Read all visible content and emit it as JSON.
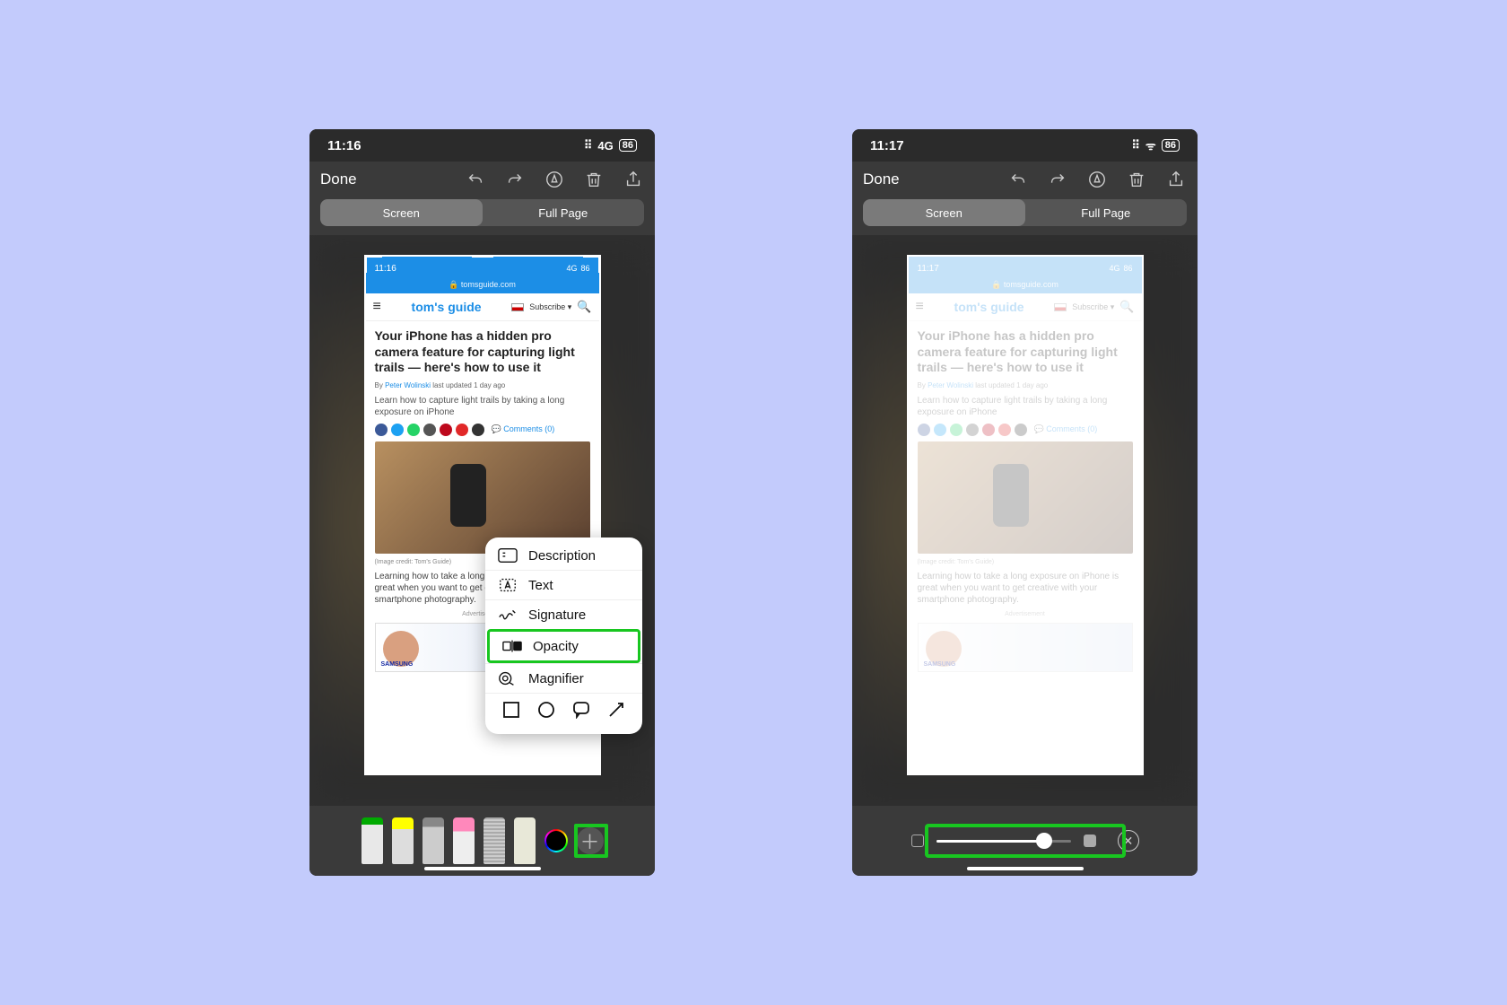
{
  "phone1": {
    "status": {
      "time": "11:16",
      "network": "4G",
      "battery": "86"
    },
    "nav": {
      "done": "Done"
    },
    "tabs": {
      "screen": "Screen",
      "fullpage": "Full Page"
    },
    "inner_status": {
      "time": "11:16",
      "network": "4G",
      "battery": "86",
      "url": "tomsguide.com"
    },
    "site": {
      "brand": "tom's guide",
      "subscribe": "Subscribe ▾"
    },
    "article": {
      "headline": "Your iPhone has a hidden pro camera feature for capturing light trails — here's how to use it",
      "by_prefix": "By ",
      "author": "Peter Wolinski",
      "by_suffix": " last updated 1 day ago",
      "sub": "Learn how to capture light trails by taking a long exposure on iPhone",
      "comments": "Comments (0)",
      "credit": "(Image credit: Tom's Guide)",
      "body": "Learning how to take a long exposure on iPhone is great when you want to get creative with your smartphone photography.",
      "adlabel": "Advertisement",
      "adtag": "SAMSUNG"
    },
    "popup": {
      "description": "Description",
      "text": "Text",
      "signature": "Signature",
      "opacity": "Opacity",
      "magnifier": "Magnifier"
    }
  },
  "phone2": {
    "status": {
      "time": "11:17",
      "network": "",
      "battery": "86"
    },
    "nav": {
      "done": "Done"
    },
    "tabs": {
      "screen": "Screen",
      "fullpage": "Full Page"
    },
    "inner_status": {
      "time": "11:17",
      "network": "4G",
      "battery": "86",
      "url": "tomsguide.com"
    },
    "site": {
      "brand": "tom's guide",
      "subscribe": "Subscribe ▾"
    },
    "article": {
      "headline": "Your iPhone has a hidden pro camera feature for capturing light trails — here's how to use it",
      "by_prefix": "By ",
      "author": "Peter Wolinski",
      "by_suffix": " last updated 1 day ago",
      "sub": "Learn how to capture light trails by taking a long exposure on iPhone",
      "comments": "Comments (0)",
      "credit": "(Image credit: Tom's Guide)",
      "body": "Learning how to take a long exposure on iPhone is great when you want to get creative with your smartphone photography.",
      "adlabel": "Advertisement",
      "adtag": "SAMSUNG"
    },
    "opacity": {
      "value_pct": 80
    }
  },
  "social_colors": [
    "#3b5998",
    "#1da1f2",
    "#25d366",
    "#ff4500",
    "#bd081c",
    "#e12828",
    "#555",
    "#333"
  ]
}
